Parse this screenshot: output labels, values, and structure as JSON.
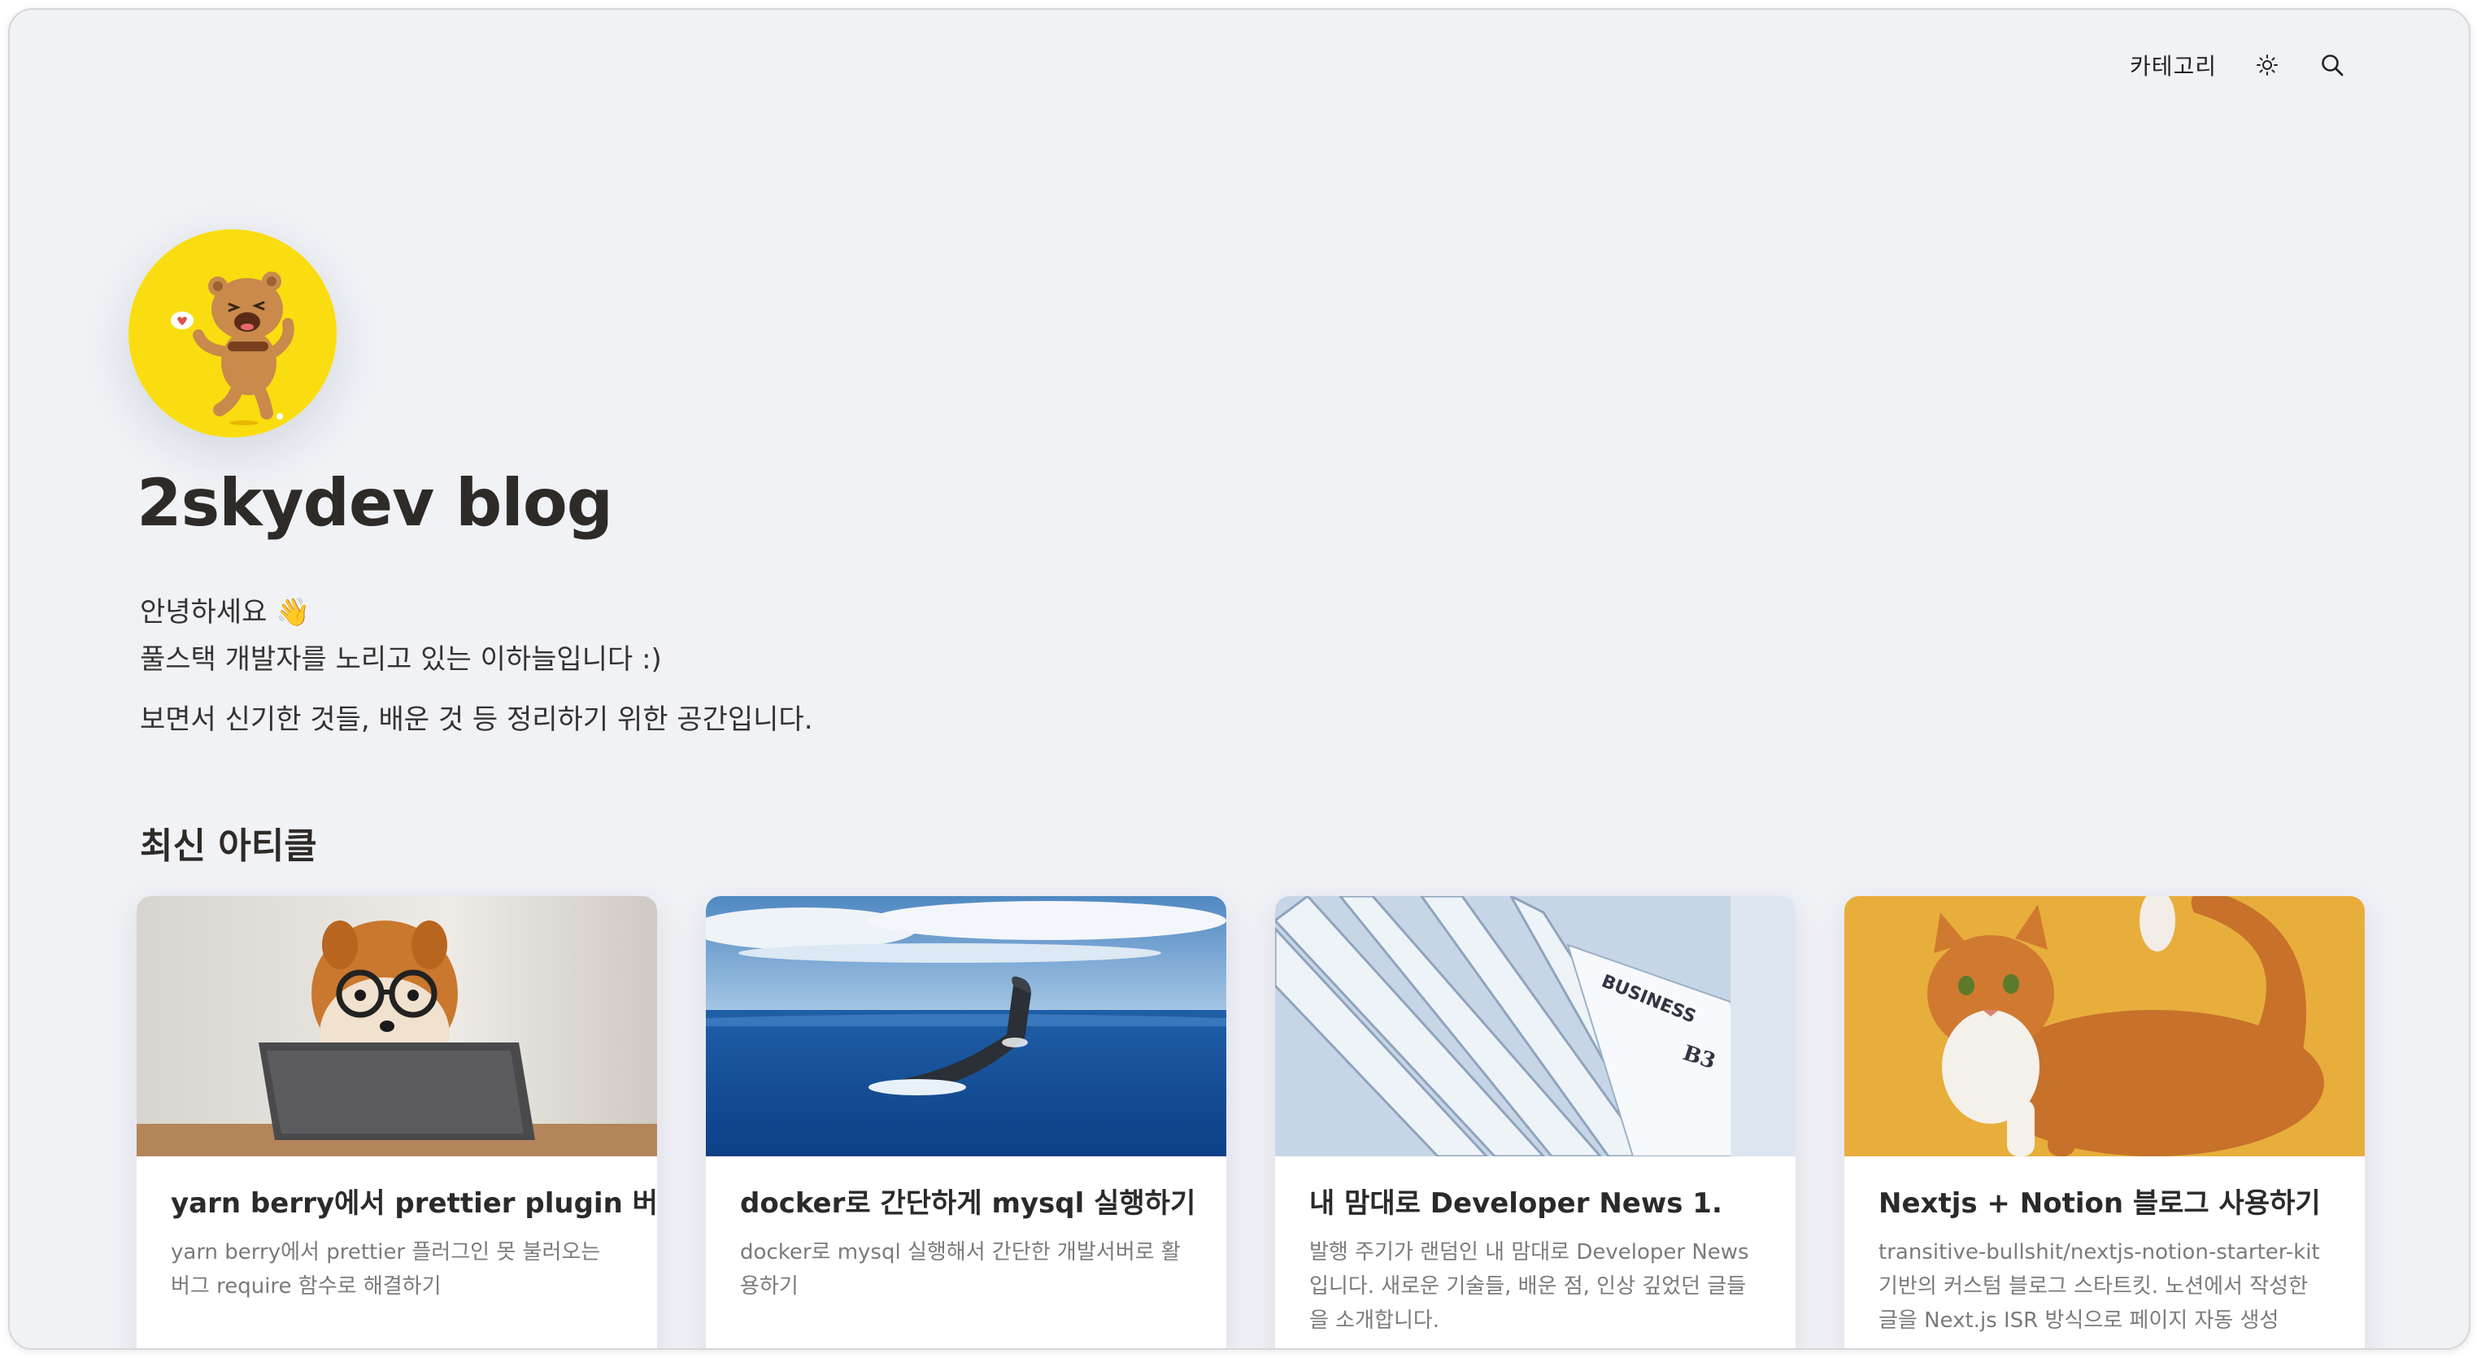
{
  "nav": {
    "category_label": "카테고리",
    "theme_icon": "sun-icon",
    "search_icon": "search-icon"
  },
  "profile": {
    "avatar_icon": "bear-character-avatar",
    "title": "2skydev blog",
    "intro_line1": "안녕하세요 👋",
    "intro_line2": "풀스택 개발자를 노리고 있는 이하늘입니다 :)",
    "intro_line3": "보면서 신기한 것들, 배운 것 등 정리하기 위한 공간입니다."
  },
  "articles": {
    "section_title": "최신 아티클",
    "items": [
      {
        "title": "yarn berry에서 prettier plugin 버그",
        "desc": "yarn berry에서 prettier 플러그인 못 불러오는 버그 require 함수로 해결하기",
        "thumbnail": "dog-with-glasses-tablet"
      },
      {
        "title": "docker로 간단하게 mysql 실행하기",
        "desc": "docker로 mysql 실행해서 간단한 개발서버로 활용하기",
        "thumbnail": "whale-tail-ocean"
      },
      {
        "title": "내 맘대로 Developer News 1.",
        "desc": "발행 주기가 랜덤인 내 맘대로 Developer News 입니다. 새로운 기술들, 배운 점, 인상 깊었던 글들을 소개합니다.",
        "thumbnail": "newspapers-stack"
      },
      {
        "title": "Nextjs + Notion 블로그 사용하기",
        "desc": "transitive-bullshit/nextjs-notion-starter-kit 기반의 커스텀 블로그 스타트킷. 노션에서 작성한 글을 Next.js ISR 방식으로 페이지 자동 생성",
        "thumbnail": "orange-cat-yellow-background"
      }
    ]
  },
  "colors": {
    "background": "#f1f2f6",
    "avatar_bg": "#f9dd10",
    "title_text": "#2e2a28",
    "desc_text": "#7b7b7b"
  }
}
